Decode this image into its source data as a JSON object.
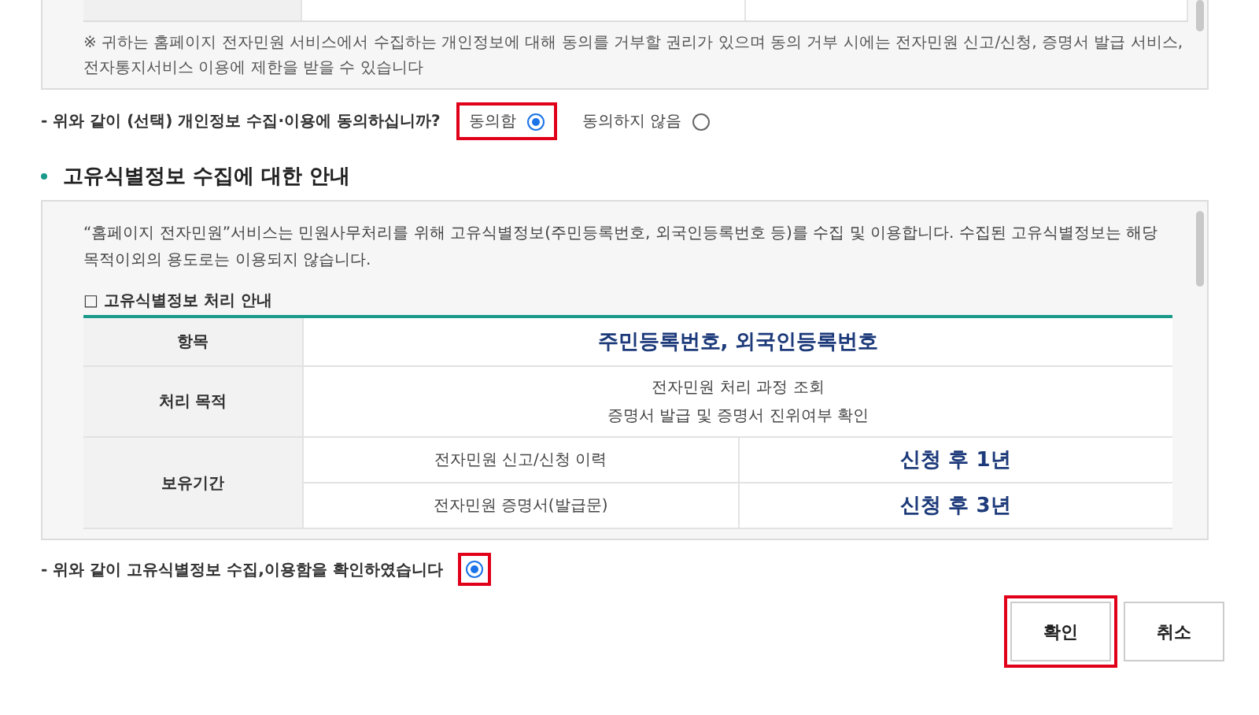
{
  "privacy_notice": {
    "text": "※ 귀하는 홈페이지 전자민원 서비스에서 수집하는 개인정보에 대해 동의를 거부할 권리가 있으며 동의 거부 시에는 전자민원 신고/신청, 증명서 발급 서비스, 전자통지서비스 이용에 제한을 받을 수 있습니다"
  },
  "privacy_consent": {
    "question": "- 위와 같이 (선택) 개인정보 수집·이용에 동의하십니까?",
    "options": [
      {
        "label": "동의함",
        "selected": true,
        "highlighted": true
      },
      {
        "label": "동의하지 않음",
        "selected": false,
        "highlighted": false
      }
    ]
  },
  "unique_id_section": {
    "title": "고유식별정보 수집에 대한 안내",
    "intro": "“홈페이지 전자민원”서비스는 민원사무처리를 위해 고유식별정보(주민등록번호, 외국인등록번호 등)를 수집 및 이용합니다. 수집된 고유식별정보는 해당 목적이외의 용도로는 이용되지 않습니다.",
    "caption": "□ 고유식별정보 처리 안내",
    "item_label": "항목",
    "item_value": "주민등록번호, 외국인등록번호",
    "purpose_label": "처리 목적",
    "purpose_lines": [
      "전자민원 처리 과정 조회",
      "증명서 발급 및 증명서 진위여부 확인"
    ],
    "retention_label": "보유기간",
    "retention_rows": [
      {
        "item": "전자민원 신고/신청 이력",
        "period": "신청 후 1년"
      },
      {
        "item": "전자민원 증명서(발급문)",
        "period": "신청 후 3년"
      }
    ]
  },
  "unique_id_consent": {
    "label": "- 위와 같이 고유식별정보 수집,이용함을 확인하였습니다",
    "checked": true,
    "highlighted": true
  },
  "buttons": [
    {
      "label": "확인",
      "highlighted": true
    },
    {
      "label": "취소",
      "highlighted": false
    }
  ]
}
